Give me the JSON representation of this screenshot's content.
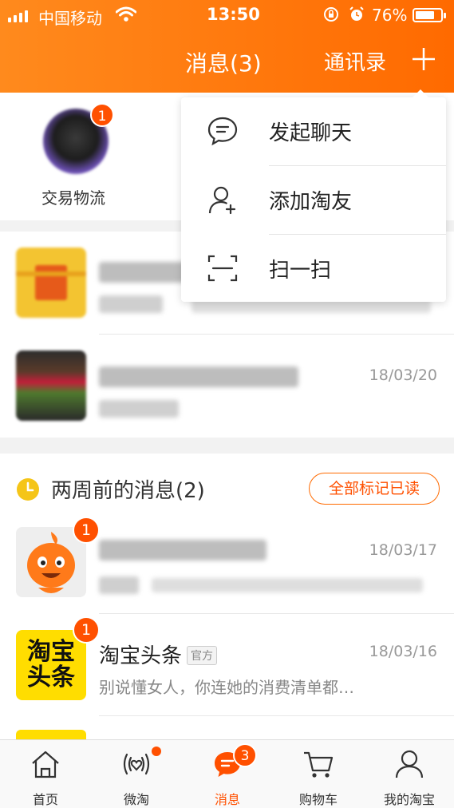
{
  "status_bar": {
    "carrier": "中国移动",
    "time": "13:50",
    "battery": "76%",
    "battery_level": 0.76
  },
  "nav": {
    "title": "消息(3)",
    "contacts": "通讯录"
  },
  "tiles": [
    {
      "label": "交易物流",
      "badge": "1"
    }
  ],
  "dropdown": {
    "items": [
      {
        "label": "发起聊天",
        "icon": "chat-bubble-icon"
      },
      {
        "label": "添加淘友",
        "icon": "add-friend-icon"
      },
      {
        "label": "扫一扫",
        "icon": "scan-icon"
      }
    ]
  },
  "recent": [
    {
      "time": ""
    },
    {
      "time": "18/03/20"
    }
  ],
  "older_section": {
    "label": "两周前的消息(2)",
    "mark_all": "全部标记已读"
  },
  "older": [
    {
      "time": "18/03/17",
      "badge": "1"
    },
    {
      "title": "淘宝头条",
      "tag": "官方",
      "time": "18/03/16",
      "preview": "别说懂女人，你连她的消费清单都…",
      "badge": "1",
      "logo_text": "淘宝\n头条"
    }
  ],
  "tabbar": {
    "items": [
      {
        "label": "首页",
        "icon": "home-icon"
      },
      {
        "label": "微淘",
        "icon": "weitao-icon"
      },
      {
        "label": "消息",
        "icon": "message-icon",
        "badge": "3"
      },
      {
        "label": "购物车",
        "icon": "cart-icon"
      },
      {
        "label": "我的淘宝",
        "icon": "profile-icon"
      }
    ]
  },
  "colors": {
    "brand": "#ff5000",
    "header_start": "#ff8a1d",
    "header_end": "#ff6a00"
  }
}
